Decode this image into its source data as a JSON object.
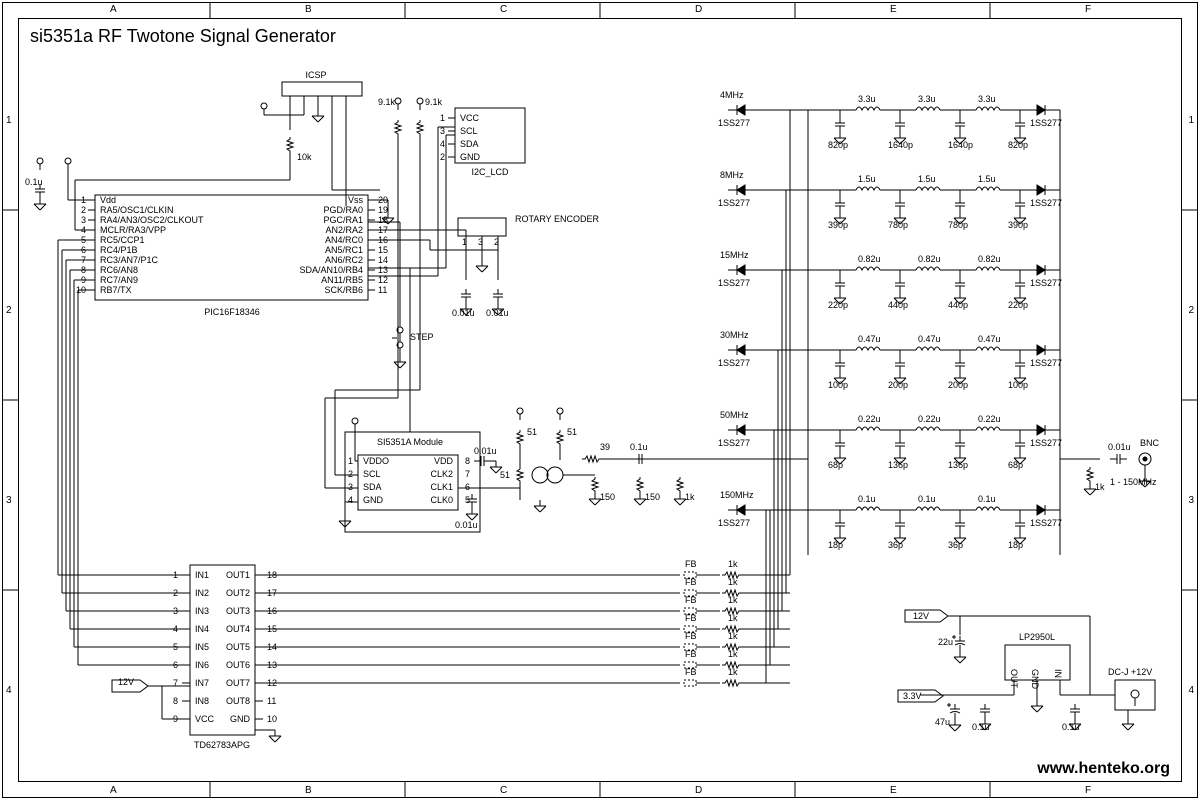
{
  "title": "si5351a RF Twotone Signal Generator",
  "url": "www.henteko.org",
  "grid_cols": [
    "A",
    "B",
    "C",
    "D",
    "E",
    "F"
  ],
  "grid_rows": [
    "1",
    "2",
    "3",
    "4"
  ],
  "mcu": {
    "name": "PIC16F18346",
    "left_pins": [
      {
        "n": "1",
        "lbl": "Vdd"
      },
      {
        "n": "2",
        "lbl": "RA5/OSC1/CLKIN"
      },
      {
        "n": "3",
        "lbl": "RA4/AN3/OSC2/CLKOUT"
      },
      {
        "n": "4",
        "lbl": "MCLR/RA3/VPP"
      },
      {
        "n": "5",
        "lbl": "RC5/CCP1"
      },
      {
        "n": "6",
        "lbl": "RC4/P1B"
      },
      {
        "n": "7",
        "lbl": "RC3/AN7/P1C"
      },
      {
        "n": "8",
        "lbl": "RC6/AN8"
      },
      {
        "n": "9",
        "lbl": "RC7/AN9"
      },
      {
        "n": "10",
        "lbl": "RB7/TX"
      }
    ],
    "right_pins": [
      {
        "n": "20",
        "lbl": "Vss"
      },
      {
        "n": "19",
        "lbl": "PGD/RA0"
      },
      {
        "n": "18",
        "lbl": "PGC/RA1"
      },
      {
        "n": "17",
        "lbl": "AN2/RA2"
      },
      {
        "n": "16",
        "lbl": "AN4/RC0"
      },
      {
        "n": "15",
        "lbl": "AN5/RC1"
      },
      {
        "n": "14",
        "lbl": "AN6/RC2"
      },
      {
        "n": "13",
        "lbl": "SDA/AN10/RB4"
      },
      {
        "n": "12",
        "lbl": "AN11/RB5"
      },
      {
        "n": "11",
        "lbl": "SCK/RB6"
      }
    ]
  },
  "driver": {
    "name": "TD62783APG",
    "left": [
      {
        "n": "1",
        "lbl": "IN1"
      },
      {
        "n": "2",
        "lbl": "IN2"
      },
      {
        "n": "3",
        "lbl": "IN3"
      },
      {
        "n": "4",
        "lbl": "IN4"
      },
      {
        "n": "5",
        "lbl": "IN5"
      },
      {
        "n": "6",
        "lbl": "IN6"
      },
      {
        "n": "7",
        "lbl": "IN7"
      },
      {
        "n": "8",
        "lbl": "IN8"
      },
      {
        "n": "9",
        "lbl": "VCC"
      }
    ],
    "right": [
      {
        "n": "18",
        "lbl": "OUT1"
      },
      {
        "n": "17",
        "lbl": "OUT2"
      },
      {
        "n": "16",
        "lbl": "OUT3"
      },
      {
        "n": "15",
        "lbl": "OUT4"
      },
      {
        "n": "14",
        "lbl": "OUT5"
      },
      {
        "n": "13",
        "lbl": "OUT6"
      },
      {
        "n": "12",
        "lbl": "OUT7"
      },
      {
        "n": "11",
        "lbl": "OUT8"
      },
      {
        "n": "10",
        "lbl": "GND"
      }
    ]
  },
  "si5351": {
    "title": "SI5351A Module",
    "left": [
      {
        "n": "1",
        "lbl": "VDDO"
      },
      {
        "n": "2",
        "lbl": "SCL"
      },
      {
        "n": "3",
        "lbl": "SDA"
      },
      {
        "n": "4",
        "lbl": "GND"
      }
    ],
    "right": [
      {
        "n": "8",
        "lbl": "VDD"
      },
      {
        "n": "7",
        "lbl": "CLK2"
      },
      {
        "n": "6",
        "lbl": "CLK1"
      },
      {
        "n": "5",
        "lbl": "CLK0"
      }
    ]
  },
  "i2c_lcd": {
    "name": "I2C_LCD",
    "pins": [
      {
        "n": "1",
        "lbl": "VCC"
      },
      {
        "n": "3",
        "lbl": "SCL"
      },
      {
        "n": "4",
        "lbl": "SDA"
      },
      {
        "n": "2",
        "lbl": "GND"
      }
    ]
  },
  "rotary": {
    "name": "ROTARY ENCODER",
    "pins": [
      "1",
      "3",
      "2"
    ]
  },
  "icsp": "ICSP",
  "step": "STEP",
  "filters": [
    {
      "freq": "4MHz",
      "diode": "1SS277",
      "L": "3.3u",
      "C_outer": "820p",
      "C_inner": "1640p"
    },
    {
      "freq": "8MHz",
      "diode": "1SS277",
      "L": "1.5u",
      "C_outer": "390p",
      "C_inner": "780p"
    },
    {
      "freq": "15MHz",
      "diode": "1SS277",
      "L": "0.82u",
      "C_outer": "220p",
      "C_inner": "440p"
    },
    {
      "freq": "30MHz",
      "diode": "1SS277",
      "L": "0.47u",
      "C_outer": "100p",
      "C_inner": "200p"
    },
    {
      "freq": "50MHz",
      "diode": "1SS277",
      "L": "0.22u",
      "C_outer": "68p",
      "C_inner": "136p"
    },
    {
      "freq": "150MHz",
      "diode": "1SS277",
      "L": "0.1u",
      "C_outer": "18p",
      "C_inner": "36p"
    }
  ],
  "fb_chain": {
    "label": "FB",
    "r": "1k",
    "count": 7
  },
  "attenuator": {
    "r_series_top": "51",
    "r_series_in": "51",
    "r_match": "39",
    "r_shunt": "150",
    "r_out": "1k"
  },
  "output": {
    "conn": "BNC",
    "range": "1 - 150MHz",
    "r": "1k",
    "c": "0.01u"
  },
  "power": {
    "reg": "LP2950L",
    "reg_pins": [
      "OUT",
      "GND",
      "IN"
    ],
    "jack": "DC-J +12V",
    "v_in": "12V",
    "v_out": "3.3V",
    "c_in": "22u",
    "c_out": "47u",
    "c_byp": "0.1u"
  },
  "misc": {
    "pullup": "9.1k",
    "pullup2": "9.1k",
    "mclr_r": "10k",
    "bypass": "0.1u",
    "decouple": "0.01u",
    "caps_rotary": "0.01u",
    "si_bypass": "0.01u",
    "drv_vcc": "12V",
    "out_cap": "0.1u"
  }
}
